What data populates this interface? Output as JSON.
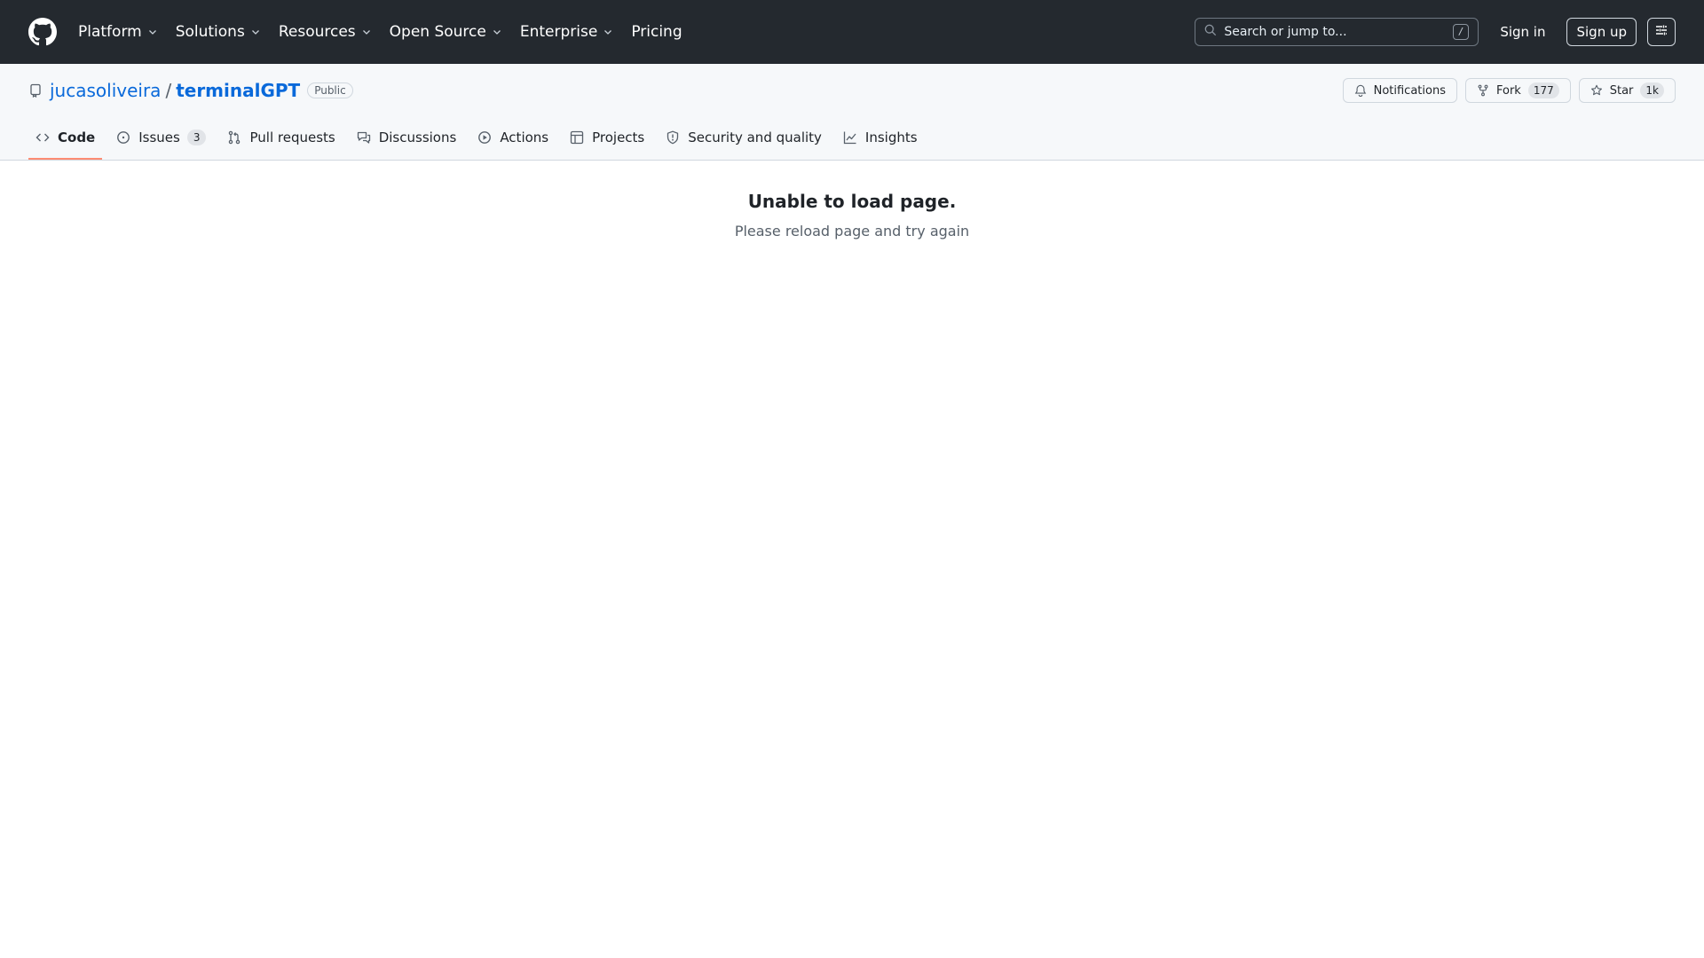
{
  "header": {
    "nav": [
      {
        "label": "Platform",
        "has_dropdown": true
      },
      {
        "label": "Solutions",
        "has_dropdown": true
      },
      {
        "label": "Resources",
        "has_dropdown": true
      },
      {
        "label": "Open Source",
        "has_dropdown": true
      },
      {
        "label": "Enterprise",
        "has_dropdown": true
      },
      {
        "label": "Pricing",
        "has_dropdown": false
      }
    ],
    "search_placeholder": "Search or jump to...",
    "search_shortcut": "/",
    "sign_in": "Sign in",
    "sign_up": "Sign up"
  },
  "repo": {
    "owner": "jucasoliveira",
    "separator": "/",
    "name": "terminalGPT",
    "visibility": "Public",
    "actions": {
      "notifications": "Notifications",
      "fork_label": "Fork",
      "fork_count": "177",
      "star_label": "Star",
      "star_count": "1k"
    },
    "tabs": [
      {
        "label": "Code",
        "active": true,
        "count": ""
      },
      {
        "label": "Issues",
        "active": false,
        "count": "3"
      },
      {
        "label": "Pull requests",
        "active": false,
        "count": ""
      },
      {
        "label": "Discussions",
        "active": false,
        "count": ""
      },
      {
        "label": "Actions",
        "active": false,
        "count": ""
      },
      {
        "label": "Projects",
        "active": false,
        "count": ""
      },
      {
        "label": "Security and quality",
        "active": false,
        "count": ""
      },
      {
        "label": "Insights",
        "active": false,
        "count": ""
      }
    ]
  },
  "main": {
    "error_title": "Unable to load page.",
    "error_subtitle": "Please reload page and try again"
  },
  "colors": {
    "header_bg": "#24292f",
    "link": "#0969da",
    "active_tab_underline": "#fd8c73"
  }
}
